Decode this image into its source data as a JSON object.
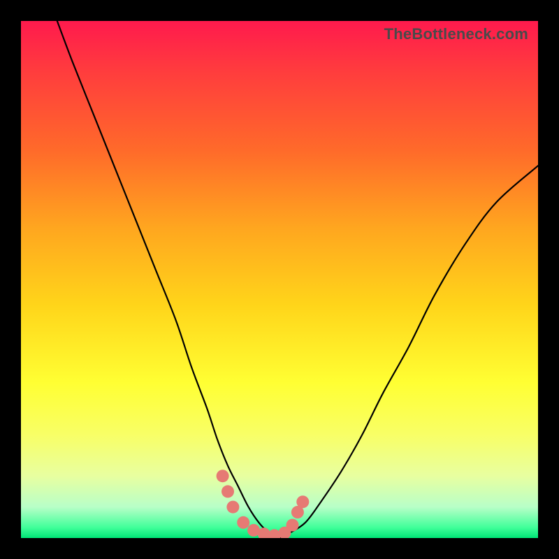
{
  "watermark": "TheBottleneck.com",
  "chart_data": {
    "type": "line",
    "title": "",
    "xlabel": "",
    "ylabel": "",
    "xlim": [
      0,
      100
    ],
    "ylim": [
      0,
      100
    ],
    "grid": false,
    "legend": false,
    "series": [
      {
        "name": "bottleneck-curve",
        "color": "#000000",
        "x": [
          7,
          10,
          14,
          18,
          22,
          26,
          30,
          33,
          36,
          38,
          40,
          42,
          44,
          46,
          48,
          50,
          52,
          55,
          58,
          62,
          66,
          70,
          75,
          80,
          86,
          92,
          100
        ],
        "y": [
          100,
          92,
          82,
          72,
          62,
          52,
          42,
          33,
          25,
          19,
          14,
          10,
          6,
          3,
          1,
          0,
          1,
          3,
          7,
          13,
          20,
          28,
          37,
          47,
          57,
          65,
          72
        ]
      }
    ],
    "markers": {
      "name": "highlight-dots",
      "color": "#e67a74",
      "radius": 9,
      "points": [
        {
          "x": 39,
          "y": 12
        },
        {
          "x": 40,
          "y": 9
        },
        {
          "x": 41,
          "y": 6
        },
        {
          "x": 43,
          "y": 3
        },
        {
          "x": 45,
          "y": 1.5
        },
        {
          "x": 47,
          "y": 0.8
        },
        {
          "x": 49,
          "y": 0.5
        },
        {
          "x": 51,
          "y": 1
        },
        {
          "x": 52.5,
          "y": 2.5
        },
        {
          "x": 53.5,
          "y": 5
        },
        {
          "x": 54.5,
          "y": 7
        }
      ]
    }
  }
}
